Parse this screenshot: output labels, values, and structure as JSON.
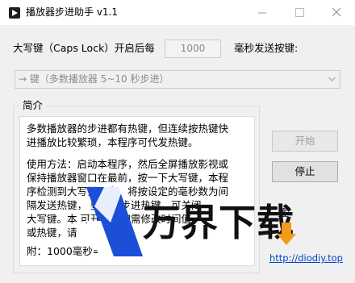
{
  "window": {
    "title": "播放器步进助手 v1.1",
    "controls": {
      "minimize": "—",
      "maximize": "☐",
      "close": "✕"
    }
  },
  "settings": {
    "capslock_label": "大写键（Caps Lock）开启后每",
    "interval_value": "1000",
    "interval_suffix": "毫秒发送按键:",
    "mode_selected": "→ 键（多数播放器 5~10 秒步进）"
  },
  "intro": {
    "group_title": "简介",
    "para1": "多数播放器的步进都有热键，但连续按热键快\n进播放比较繁琐，本程序可代发热键。",
    "para2": "使用方法：启动本程序，然后全屏播放影视或\n保持播放器窗口在最前，按一下大写键，本程\n序检测到大写键开启，将按设定的毫秒数为间\n隔发送热键，              要发送步进热键，可关闭\n大写键。本            可开关，如需修改时间值\n或热键，请",
    "para3": "附：1000毫秒=1秒"
  },
  "buttons": {
    "start": "开始",
    "stop": "停止",
    "partial_label": "置"
  },
  "footer": {
    "link": "http://diodiy.top"
  },
  "watermark": {
    "text": "万界下载"
  },
  "colors": {
    "link": "#0044cc",
    "watermark_blue": "#1b4fd8",
    "watermark_orange": "#f39a1c"
  }
}
